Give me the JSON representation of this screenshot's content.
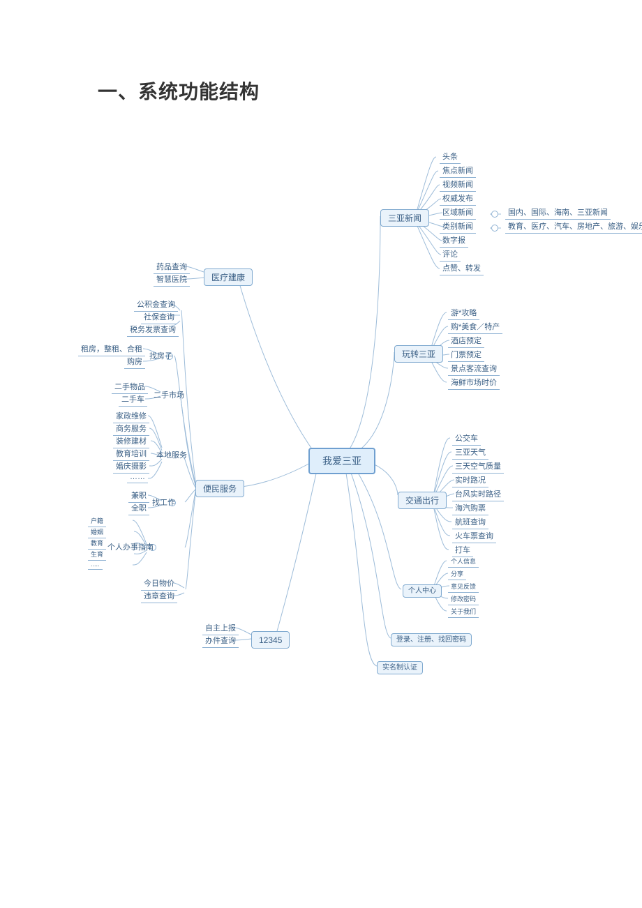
{
  "title": "一、系统功能结构",
  "center": "我爱三亚",
  "branches": {
    "news": {
      "label": "三亚新闻",
      "items": [
        "头条",
        "焦点新闻",
        "视频新闻",
        "权威发布",
        "区域新闻",
        "类别新闻",
        "数字报",
        "评论",
        "点赞、转发"
      ],
      "region_note": "国内、国际、海南、三亚新闻",
      "category_note": "教育、医疗、汽车、房地产、旅游、娱乐"
    },
    "play": {
      "label": "玩转三亚",
      "items": [
        "游*攻略",
        "购*美食／特产",
        "酒店预定",
        "门票预定",
        "景点客流查询",
        "海鲜市场时价"
      ]
    },
    "traffic": {
      "label": "交通出行",
      "items": [
        "公交车",
        "三亚天气",
        "三天空气质量",
        "实时路况",
        "台风实时路径",
        "海汽购票",
        "航班查询",
        "火车票查询",
        "打车"
      ]
    },
    "profile": {
      "label": "个人中心",
      "items": [
        "个人信息",
        "分享",
        "意见反馈",
        "修改密码",
        "关于我们"
      ]
    },
    "login": {
      "label": "登录、注册、找回密码"
    },
    "realname": {
      "label": "实名制认证"
    },
    "hotline": {
      "label": "12345",
      "items": [
        "自主上报",
        "办件查询"
      ]
    },
    "civic": {
      "label": "便民服务",
      "top3": [
        "公积金查询",
        "社保查询",
        "税务发票查询"
      ],
      "house": {
        "label": "找房子",
        "items": [
          "租房，整租、合租",
          "购房"
        ]
      },
      "second": {
        "label": "二手市场",
        "items": [
          "二手物品",
          "二手车"
        ]
      },
      "local": {
        "label": "本地服务",
        "items": [
          "家政维修",
          "商务服务",
          "装修建材",
          "教育培训",
          "婚庆摄影",
          "……"
        ]
      },
      "job": {
        "label": "找工作",
        "items": [
          "兼职",
          "全职"
        ]
      },
      "guide": {
        "label": "个人办事指南",
        "items": [
          "户籍",
          "婚姻",
          "教育",
          "生育",
          "....."
        ]
      },
      "bottom2": [
        "今日物价",
        "违章查询"
      ]
    },
    "health": {
      "label": "医疗建康",
      "items": [
        "药品查询",
        "智慧医院"
      ]
    }
  }
}
